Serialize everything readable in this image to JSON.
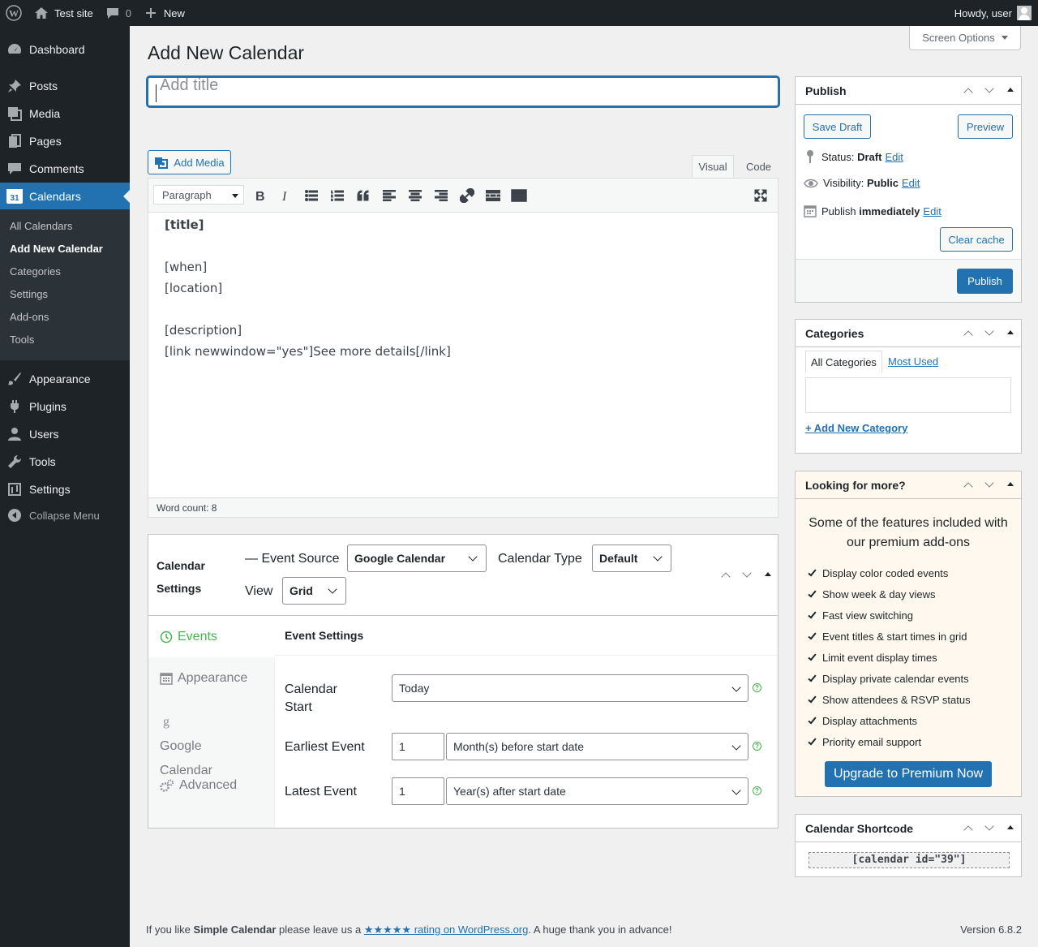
{
  "admin_bar": {
    "site_name": "Test site",
    "comments_count": "0",
    "new_label": "New",
    "greeting": "Howdy, user"
  },
  "sidebar": {
    "items": [
      {
        "label": "Dashboard",
        "icon": "dashboard-icon"
      },
      {
        "label": "Posts",
        "icon": "pin-icon"
      },
      {
        "label": "Media",
        "icon": "media-icon"
      },
      {
        "label": "Pages",
        "icon": "pages-icon"
      },
      {
        "label": "Comments",
        "icon": "comment-icon"
      },
      {
        "label": "Calendars",
        "icon": "calendar-icon",
        "badge": "31"
      },
      {
        "label": "Appearance",
        "icon": "brush-icon"
      },
      {
        "label": "Plugins",
        "icon": "plugin-icon"
      },
      {
        "label": "Users",
        "icon": "user-icon"
      },
      {
        "label": "Tools",
        "icon": "wrench-icon"
      },
      {
        "label": "Settings",
        "icon": "settings-icon"
      },
      {
        "label": "Collapse Menu",
        "icon": "collapse-icon"
      }
    ],
    "submenu": [
      "All Calendars",
      "Add New Calendar",
      "Categories",
      "Settings",
      "Add-ons",
      "Tools"
    ]
  },
  "screen_options": "Screen Options",
  "page_title": "Add New Calendar",
  "title_placeholder": "Add title",
  "editor": {
    "add_media": "Add Media",
    "tab_visual": "Visual",
    "tab_code": "Code",
    "format": "Paragraph",
    "content": [
      "[title]",
      "",
      "[when]",
      "[location]",
      "",
      "[description]",
      "[link newwindow=\"yes\"]See more details[/link]"
    ],
    "word_count": "Word count: 8"
  },
  "calendar_settings": {
    "title": "Calendar Settings",
    "event_source_label": "— Event Source",
    "event_source": "Google Calendar",
    "calendar_type_label": "Calendar Type",
    "calendar_type": "Default",
    "view_label": "View",
    "view": "Grid",
    "tabs": [
      "Events",
      "Appearance",
      "Google Calendar",
      "Advanced"
    ],
    "panel_title": "Event Settings",
    "fields": {
      "calendar_start_label": "Calendar Start",
      "calendar_start": "Today",
      "earliest_label": "Earliest Event",
      "earliest_value": "1",
      "earliest_unit": "Month(s) before start date",
      "latest_label": "Latest Event",
      "latest_value": "1",
      "latest_unit": "Year(s) after start date"
    }
  },
  "publish": {
    "title": "Publish",
    "save_draft": "Save Draft",
    "preview": "Preview",
    "status_label": "Status:",
    "status_value": "Draft",
    "visibility_label": "Visibility:",
    "visibility_value": "Public",
    "publish_label": "Publish",
    "publish_value": "immediately",
    "edit": "Edit",
    "clear_cache": "Clear cache",
    "publish_button": "Publish"
  },
  "categories": {
    "title": "Categories",
    "tab_all": "All Categories",
    "tab_most_used": "Most Used",
    "add_new": "+ Add New Category"
  },
  "promo": {
    "title": "Looking for more?",
    "intro": "Some of the features included with our premium add-ons",
    "features": [
      "Display color coded events",
      "Show week & day views",
      "Fast view switching",
      "Event titles & start times in grid",
      "Limit event display times",
      "Display private calendar events",
      "Show attendees & RSVP status",
      "Display attachments",
      "Priority email support"
    ],
    "button": "Upgrade to Premium Now",
    "accent": "#fef8ee"
  },
  "shortcode": {
    "title": "Calendar Shortcode",
    "code": "[calendar id=\"39\"]"
  },
  "footer": {
    "prefix": "If you like ",
    "plugin": "Simple Calendar",
    "middle": " please leave us a ",
    "link": "★★★★★ rating on WordPress.org",
    "suffix": ". A huge thank you in advance!",
    "version": "Version 6.8.2"
  },
  "colors": {
    "admin_dark": "#1d2327",
    "primary": "#2271b1",
    "success": "#46b450"
  }
}
